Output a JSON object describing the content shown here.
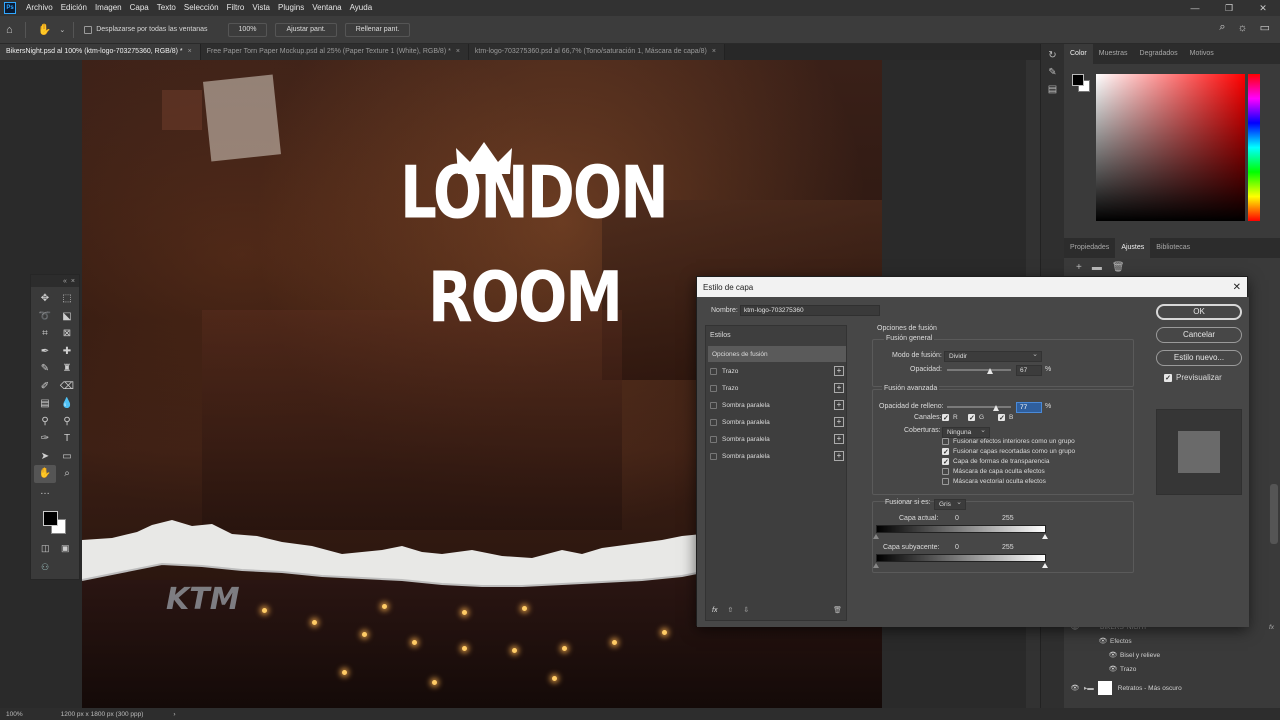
{
  "app": {
    "menu": [
      "Archivo",
      "Edición",
      "Imagen",
      "Capa",
      "Texto",
      "Selección",
      "Filtro",
      "Vista",
      "Plugins",
      "Ventana",
      "Ayuda"
    ],
    "logo": "Ps"
  },
  "options_bar": {
    "scroll_all_label": "Desplazarse por todas las ventanas",
    "zoom_btn": "100%",
    "fit_btn": "Ajustar pant.",
    "fill_btn": "Rellenar pant."
  },
  "tabs": [
    {
      "label": "BikersNight.psd al 100% (ktm-logo-703275360, RGB/8) *",
      "active": true
    },
    {
      "label": "Free Paper Torn Paper Mockup.psd al 25% (Paper Texture 1 (White), RGB/8) *",
      "active": false
    },
    {
      "label": "ktm-logo-703275360.psd al 66,7% (Tono/saturación 1, Máscara de capa/8)",
      "active": false
    }
  ],
  "canvas": {
    "logo_line1": "LONDON",
    "logo_line2": "ROOM",
    "ktm_text": "KTM"
  },
  "status": {
    "zoom": "100%",
    "dims": "1200 px x 1800 px (300 ppp)"
  },
  "right_panel": {
    "color_tabs": [
      "Color",
      "Muestras",
      "Degradados",
      "Motivos"
    ],
    "adjust_tabs": [
      "Propiedades",
      "Ajustes",
      "Bibliotecas"
    ],
    "layers": [
      {
        "name": "BIKERS' NIGHT",
        "indent": 0
      },
      {
        "name": "Efectos",
        "indent": 1
      },
      {
        "name": "Bisel y relieve",
        "indent": 2
      },
      {
        "name": "Trazo",
        "indent": 2
      },
      {
        "name": "Retratos - Más oscuro",
        "indent": 0
      }
    ]
  },
  "dialog": {
    "title": "Estilo de capa",
    "name_label": "Nombre:",
    "name_value": "ktm-logo-703275360",
    "styles_header": "Estilos",
    "styles": [
      {
        "label": "Opciones de fusión",
        "selected": true,
        "has_checkbox": false,
        "has_plus": false
      },
      {
        "label": "Trazo",
        "selected": false,
        "has_checkbox": true,
        "has_plus": true
      },
      {
        "label": "Trazo",
        "selected": false,
        "has_checkbox": true,
        "has_plus": true
      },
      {
        "label": "Sombra paralela",
        "selected": false,
        "has_checkbox": true,
        "has_plus": true
      },
      {
        "label": "Sombra paralela",
        "selected": false,
        "has_checkbox": true,
        "has_plus": true
      },
      {
        "label": "Sombra paralela",
        "selected": false,
        "has_checkbox": true,
        "has_plus": true
      },
      {
        "label": "Sombra paralela",
        "selected": false,
        "has_checkbox": true,
        "has_plus": true
      }
    ],
    "options": {
      "section_title": "Opciones de fusión",
      "general_title": "Fusión general",
      "blend_mode_label": "Modo de fusión:",
      "blend_mode_value": "Dividir",
      "opacity_label": "Opacidad:",
      "opacity_value": "67",
      "opacity_fraction": 0.67,
      "percent": "%",
      "advanced_title": "Fusión avanzada",
      "fill_opacity_label": "Opacidad de relleno:",
      "fill_opacity_value": "77",
      "fill_opacity_fraction": 0.77,
      "channels_label": "Canales:",
      "channel_r": "R",
      "channel_g": "G",
      "channel_b": "B",
      "knockout_label": "Coberturas:",
      "knockout_value": "Ninguna",
      "checks": [
        {
          "label": "Fusionar efectos interiores como un grupo",
          "checked": false
        },
        {
          "label": "Fusionar capas recortadas como un grupo",
          "checked": true
        },
        {
          "label": "Capa de formas de transparencia",
          "checked": true
        },
        {
          "label": "Máscara de capa oculta efectos",
          "checked": false
        },
        {
          "label": "Máscara vectorial oculta efectos",
          "checked": false
        }
      ],
      "blend_if_label": "Fusionar si es:",
      "blend_if_value": "Gris",
      "current_layer_label": "Capa actual:",
      "underlying_layer_label": "Capa subyacente:",
      "range_min": "0",
      "range_max": "255"
    },
    "buttons": {
      "ok": "OK",
      "cancel": "Cancelar",
      "new_style": "Estilo nuevo...",
      "preview": "Previsualizar"
    }
  }
}
